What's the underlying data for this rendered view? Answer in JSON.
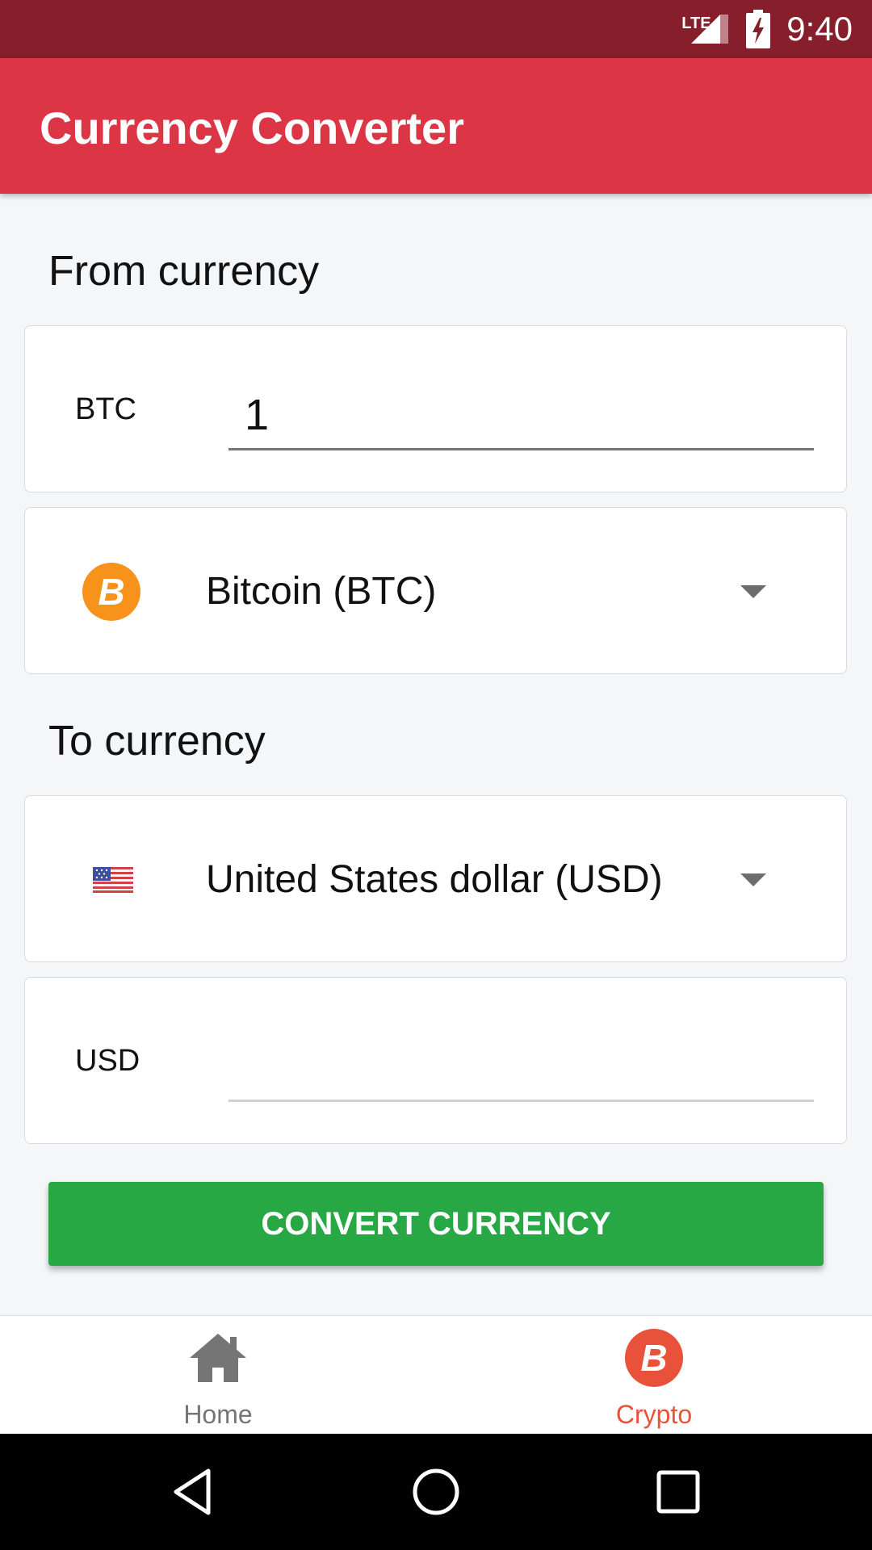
{
  "status_bar": {
    "network": "LTE",
    "time": "9:40"
  },
  "app_bar": {
    "title": "Currency Converter"
  },
  "from_section": {
    "label": "From currency",
    "code": "BTC",
    "amount_value": "1",
    "selected_currency": "Bitcoin (BTC)",
    "icon": "bitcoin-icon",
    "icon_color": "#f7931a"
  },
  "to_section": {
    "label": "To currency",
    "selected_currency": "United States dollar (USD)",
    "icon": "us-flag-icon",
    "code": "USD",
    "amount_value": ""
  },
  "convert_button": {
    "label": "CONVERT CURRENCY",
    "color": "#28a745"
  },
  "bottom_nav": {
    "items": [
      {
        "label": "Home",
        "icon": "home-icon",
        "active": false
      },
      {
        "label": "Crypto",
        "icon": "bitcoin-icon",
        "active": true,
        "color": "#e8523a"
      }
    ]
  },
  "colors": {
    "status_bar": "#861f2b",
    "app_bar": "#dc3545",
    "background": "#f5f6f8"
  }
}
